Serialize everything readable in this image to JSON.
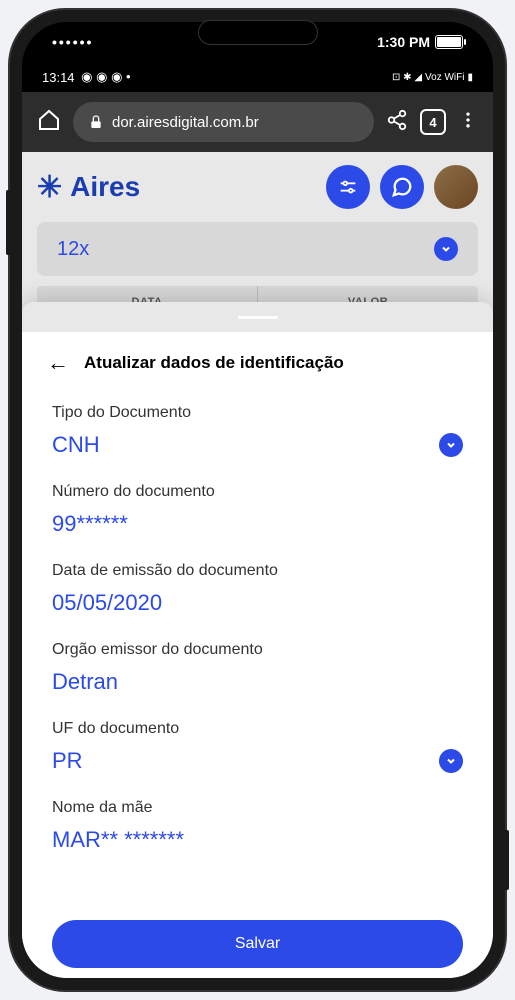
{
  "frame": {
    "outer_time": "1:30 PM",
    "android_time": "13:14",
    "android_net": "Voz WiFi"
  },
  "browser": {
    "url": "dor.airesdigital.com.br",
    "tab_count": "4"
  },
  "header": {
    "brand": "Aires"
  },
  "background": {
    "installments": "12x",
    "col_data": "DATA",
    "col_valor": "VALOR"
  },
  "sheet": {
    "title": "Atualizar dados de identificação",
    "save_label": "Salvar"
  },
  "form": {
    "tipo": {
      "label": "Tipo do Documento",
      "value": "CNH"
    },
    "numero": {
      "label": "Número do documento",
      "value": "99******"
    },
    "data_emissao": {
      "label": "Data de emissão do documento",
      "value": "05/05/2020"
    },
    "orgao": {
      "label": "Orgão emissor do documento",
      "value": "Detran"
    },
    "uf": {
      "label": "UF do documento",
      "value": "PR"
    },
    "nome_mae": {
      "label": "Nome da mãe",
      "value": "MAR** *******"
    }
  }
}
